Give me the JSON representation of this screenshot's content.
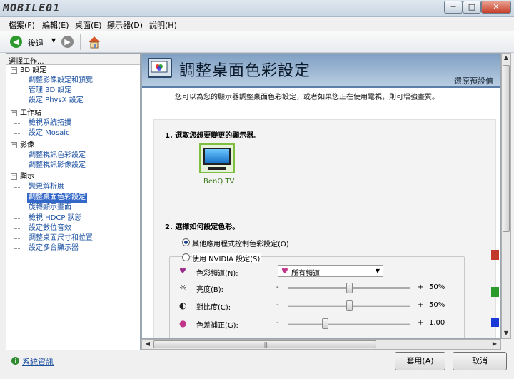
{
  "window": {
    "logo": "MOBILE01",
    "minimize": "─",
    "maximize": "□",
    "close": "✕"
  },
  "menu": [
    "檔案(F)",
    "編輯(E)",
    "桌面(E)",
    "顯示器(D)",
    "說明(H)"
  ],
  "toolbar": {
    "back_label": "後退",
    "back_icon": "green-arrow-left-icon",
    "forward_icon": "gray-arrow-right-icon",
    "home_icon": "home-icon"
  },
  "sidebar": {
    "title": "選擇工作...",
    "groups": [
      {
        "label": "3D 設定",
        "items": [
          "調整影像設定和預覽",
          "管理 3D 設定",
          "設定 PhysX 設定"
        ]
      },
      {
        "label": "工作站",
        "items": [
          "檢視系統拓撲",
          "設定 Mosaic"
        ]
      },
      {
        "label": "影像",
        "items": [
          "調整視訊色彩設定",
          "調整視訊影像設定"
        ]
      },
      {
        "label": "顯示",
        "items": [
          "變更解析度",
          "調整桌面色彩設定",
          "旋轉顯示畫面",
          "檢視 HDCP 狀態",
          "設定數位音效",
          "調整桌面尺寸和位置",
          "設定多台顯示器"
        ]
      }
    ],
    "selected": "調整桌面色彩設定"
  },
  "main": {
    "title": "調整桌面色彩設定",
    "restore_defaults": "還原預設值",
    "description": "您可以為您的顯示器調整桌面色彩設定，或者如果您正在使用電視，則可增強畫質。",
    "section1_title": "1. 選取您想要變更的顯示器。",
    "monitor_label": "BenQ TV",
    "section2_title": "2. 選擇如何設定色彩。",
    "option_other_app": "其他應用程式控制色彩設定(O)",
    "option_nvidia": "使用 NVIDIA 設定(S)",
    "channel_label": "色彩頻道(N):",
    "channel_value": "所有頻道",
    "sliders": [
      {
        "label": "亮度(B):",
        "minus": "-",
        "plus": "+",
        "value": "50%",
        "fraction": 0.5
      },
      {
        "label": "對比度(C):",
        "minus": "-",
        "plus": "+",
        "value": "50%",
        "fraction": 0.5
      },
      {
        "label": "色差補正(G):",
        "minus": "-",
        "plus": "+",
        "value": "1.00",
        "fraction": 0.3
      }
    ]
  },
  "footer": {
    "system_info": "系統資訊",
    "apply": "套用(A)",
    "cancel": "取消"
  },
  "colors": {
    "accent_blue": "#3367c8",
    "banner": "#7f9fc3",
    "link": "#1a4fa0"
  }
}
